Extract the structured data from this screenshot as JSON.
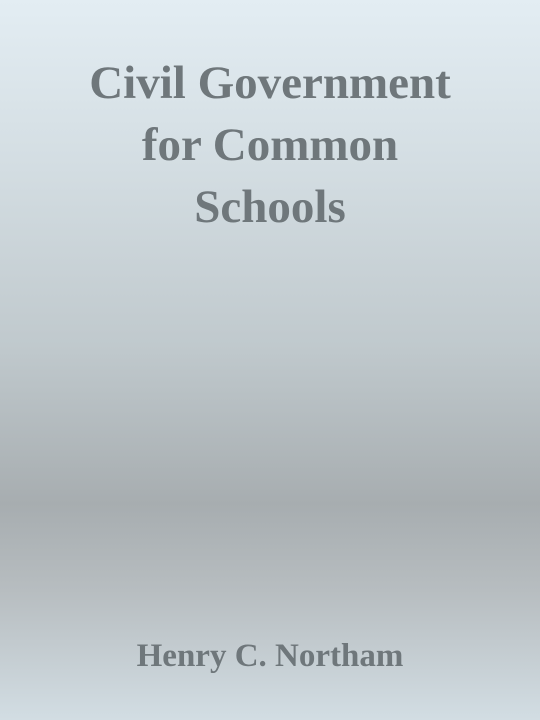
{
  "cover": {
    "title_lines": [
      "Civil Government",
      "for Common",
      "Schools"
    ],
    "author": "Henry C. Northam"
  },
  "colors": {
    "text": "#6f777b",
    "gradient_top": "#e3edf3",
    "gradient_middle": "#a7adb0",
    "gradient_bottom": "#d2dde3"
  }
}
